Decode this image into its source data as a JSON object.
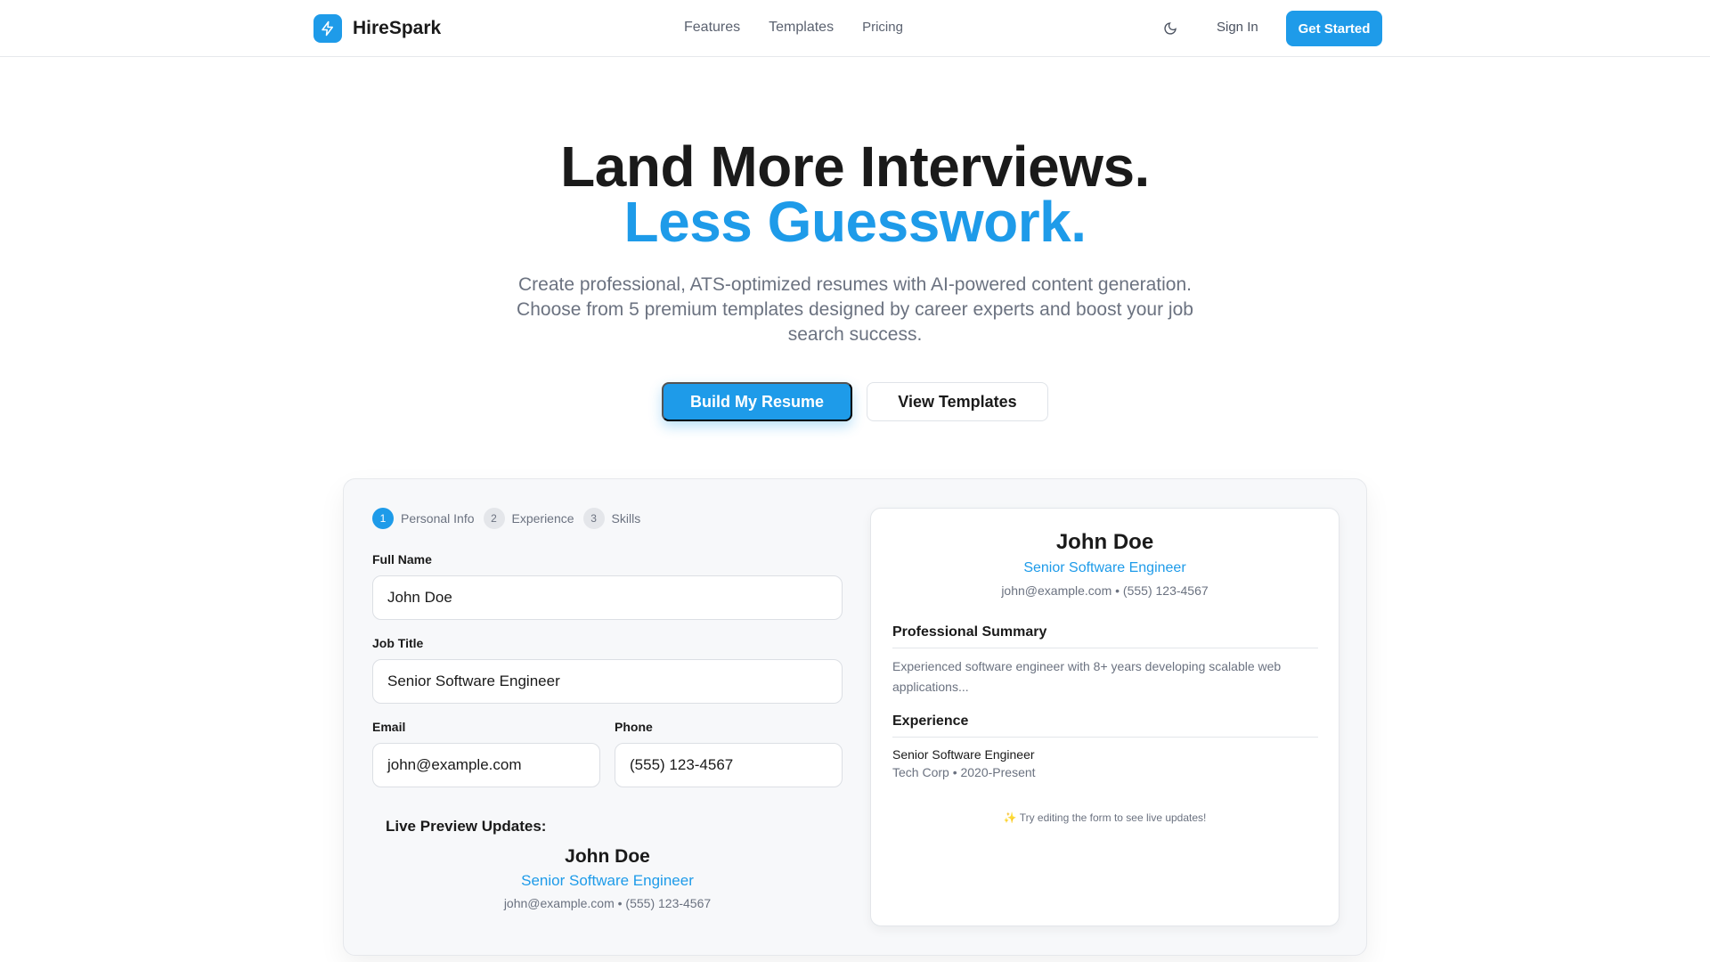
{
  "brand": {
    "name": "HireSpark",
    "logo_icon": "bolt-icon"
  },
  "nav": {
    "items": [
      "Features",
      "Templates",
      "Pricing"
    ]
  },
  "header_actions": {
    "theme_icon": "moon-icon",
    "sign_in": "Sign In",
    "get_started": "Get Started"
  },
  "hero": {
    "title_line1": "Land More Interviews.",
    "title_line2": "Less Guesswork.",
    "subtitle": "Create professional, ATS-optimized resumes with AI-powered content generation. Choose from 5 premium templates designed by career experts and boost your job search success.",
    "cta_primary": "Build My Resume",
    "cta_secondary": "View Templates"
  },
  "form": {
    "steps": [
      {
        "num": "1",
        "label": "Personal Info"
      },
      {
        "num": "2",
        "label": "Experience"
      },
      {
        "num": "3",
        "label": "Skills"
      }
    ],
    "full_name_label": "Full Name",
    "full_name_value": "John Doe",
    "job_title_label": "Job Title",
    "job_title_value": "Senior Software Engineer",
    "email_label": "Email",
    "email_value": "john@example.com",
    "phone_label": "Phone",
    "phone_value": "(555) 123-4567",
    "live_label": "Live Preview Updates:",
    "live_name": "John Doe",
    "live_title": "Senior Software Engineer",
    "live_contact": "john@example.com • (555) 123-4567"
  },
  "preview": {
    "name": "John Doe",
    "title": "Senior Software Engineer",
    "contact": "john@example.com • (555) 123-4567",
    "summary_heading": "Professional Summary",
    "summary_text": "Experienced software engineer with 8+ years developing scalable web applications...",
    "experience_heading": "Experience",
    "job_title": "Senior Software Engineer",
    "job_company": "Tech Corp • 2020-Present",
    "tip": "✨ Try editing the form to see live updates!"
  },
  "colors": {
    "accent": "#1e9be9",
    "text": "#1a1a1a",
    "muted": "#6b7280"
  }
}
